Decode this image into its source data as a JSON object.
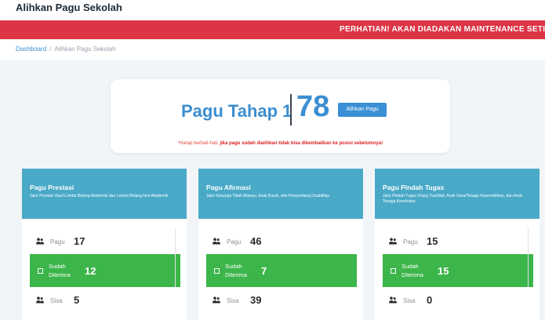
{
  "header": {
    "title": "Alihkan Pagu Sekolah"
  },
  "alert": {
    "text": "PERHATIAN! AKAN DIADAKAN MAINTENANCE SETIAP"
  },
  "breadcrumb": {
    "home": "Dashboard",
    "separator": "/",
    "current": "Alihkan Pagu Sekolah"
  },
  "hero": {
    "title": "Pagu Tahap 1",
    "number": "78",
    "button_label": "Alihkan Pagu",
    "note_prefix": "*Harap berhati-hati, ",
    "note_emphasis": "jika pagu sudah dialihkan tidak bisa dikembalikan ke posisi sebelumnya!"
  },
  "labels": {
    "pagu": "Pagu",
    "diterima": "Sudah Diterima",
    "sisa": "Sisa"
  },
  "colors": {
    "header": "#49a9c7",
    "accent": "#3b8ed1",
    "success": "#3cb54a",
    "alert": "#dc3545"
  },
  "columns": [
    {
      "title": "Pagu Prestasi",
      "desc": "Jalur Prestasi Hasil Lomba Bidang Akademik dan Lomba Bidang Non Akademik",
      "pagu": "17",
      "diterima": "12",
      "sisa": "5"
    },
    {
      "title": "Pagu Afirmasi",
      "desc": "Jalur Keluarga Tidak Mampu, Anak Buruh, dan Penyandang Disabilitas",
      "pagu": "46",
      "diterima": "7",
      "sisa": "39"
    },
    {
      "title": "Pagu Pindah Tugas",
      "desc": "Jalur Pindah Tugas Orang Tua/Wali, Anak Guru/Tenaga Kependidikan, dan Anak Tenaga Kesehatan",
      "pagu": "15",
      "diterima": "15",
      "sisa": "0"
    }
  ]
}
